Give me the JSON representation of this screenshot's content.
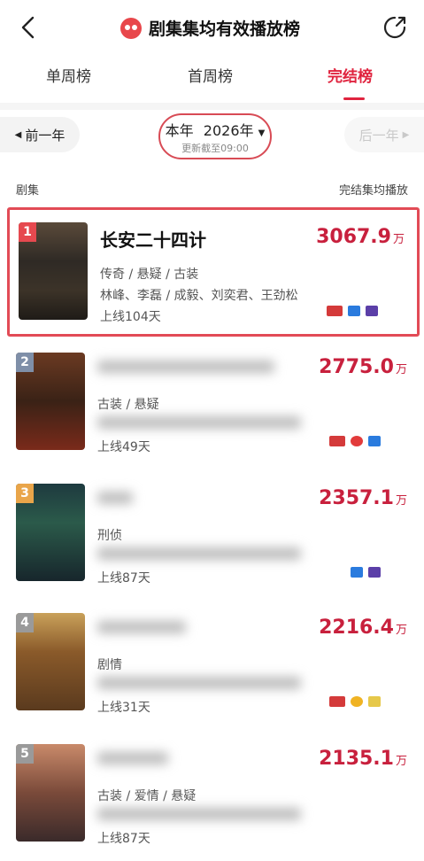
{
  "header": {
    "title": "剧集集均有效播放榜"
  },
  "tabs": [
    {
      "label": "单周榜"
    },
    {
      "label": "首周榜"
    },
    {
      "label": "完结榜"
    }
  ],
  "year_nav": {
    "prev_label": "前一年",
    "next_label": "后一年",
    "year_prefix": "本年",
    "year_value": "2026年",
    "update_note": "更新截至09:00"
  },
  "columns": {
    "left": "剧集",
    "right": "完结集均播放"
  },
  "rows": [
    {
      "rank": "1",
      "name": "长安二十四计",
      "genre": "传奇 / 悬疑 / 古装",
      "cast": "林峰、李磊 / 成毅、刘奕君、王劲松",
      "days": "上线104天",
      "value": "3067.9",
      "unit": "万",
      "rank_color": "#e6494f"
    },
    {
      "rank": "2",
      "name": "",
      "genre": "古装 / 悬疑",
      "cast": "",
      "days": "上线49天",
      "value": "2775.0",
      "unit": "万",
      "rank_color": "#7f8fa8"
    },
    {
      "rank": "3",
      "name": "",
      "genre": "刑侦",
      "cast": "",
      "days": "上线87天",
      "value": "2357.1",
      "unit": "万",
      "rank_color": "#e9a54a"
    },
    {
      "rank": "4",
      "name": "",
      "genre": "剧情",
      "cast": "",
      "days": "上线31天",
      "value": "2216.4",
      "unit": "万",
      "rank_color": "#9a9a9a"
    },
    {
      "rank": "5",
      "name": "",
      "genre": "古装 / 爱情 / 悬疑",
      "cast": "",
      "days": "上线87天",
      "value": "2135.1",
      "unit": "万",
      "rank_color": "#9a9a9a"
    }
  ]
}
